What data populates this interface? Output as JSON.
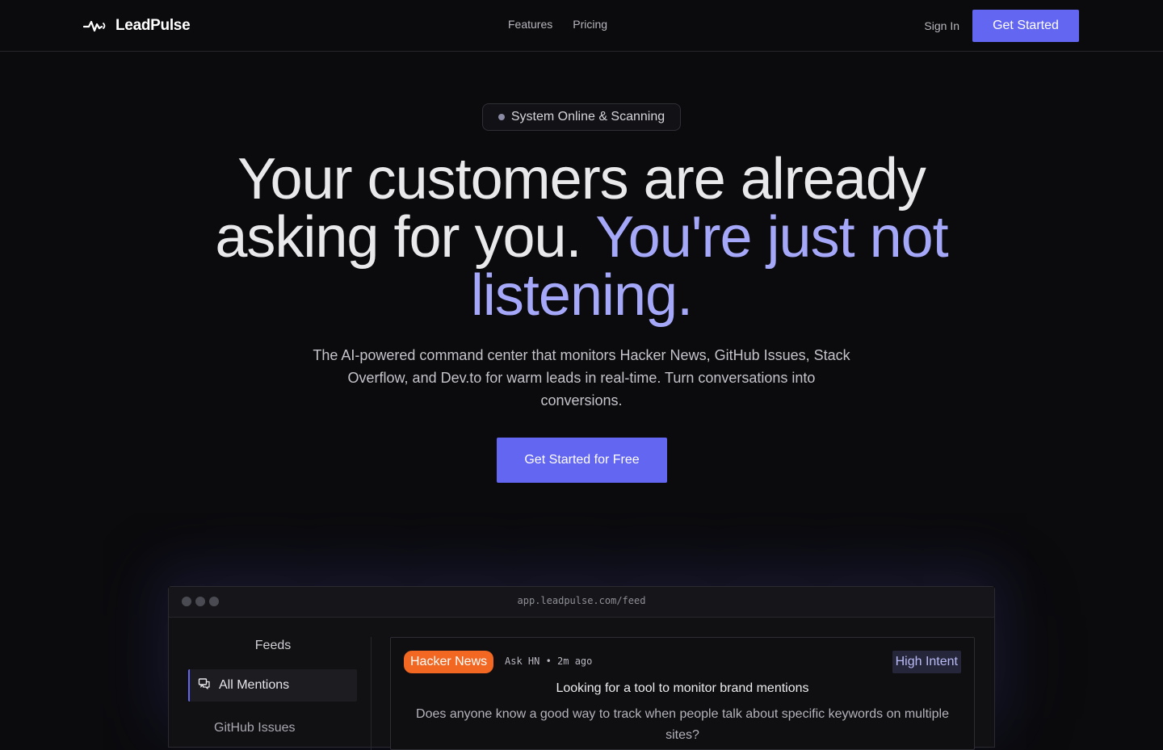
{
  "nav": {
    "brand": "LeadPulse",
    "links": [
      "Features",
      "Pricing"
    ],
    "sign_in": "Sign In",
    "cta": "Get Started"
  },
  "hero": {
    "badge": "System Online & Scanning",
    "headline_main": "Your customers are already asking for you.",
    "headline_accent": "You're just not listening.",
    "subtitle": "The AI-powered command center that monitors Hacker News, GitHub Issues, Stack Overflow, and Dev.to for warm leads in real-time. Turn conversations into conversions.",
    "cta": "Get Started for Free"
  },
  "app_preview": {
    "url": "app.leadpulse.com/feed",
    "sidebar": {
      "title": "Feeds",
      "items": [
        {
          "label": "All Mentions",
          "icon": "chat-bubbles-icon",
          "active": true
        },
        {
          "label": "GitHub Issues",
          "icon": "github-icon",
          "active": false
        }
      ]
    },
    "card": {
      "source": "Hacker News",
      "meta": "Ask HN • 2m ago",
      "intent": "High Intent",
      "title": "Looking for a tool to monitor brand mentions",
      "body": "Does anyone know a good way to track when people talk about specific keywords on multiple sites?"
    }
  },
  "colors": {
    "accent": "#6366f1",
    "accent_text": "#a5a8f8",
    "hn_orange": "#f26722",
    "background": "#0b0b0d"
  }
}
